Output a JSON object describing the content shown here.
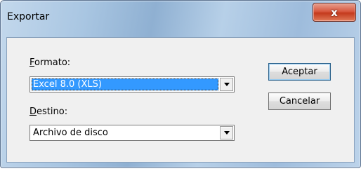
{
  "window": {
    "title": "Exportar",
    "close_label": "x"
  },
  "form": {
    "formato_label_accel": "F",
    "formato_label_rest": "ormato:",
    "formato_value": "Excel 8.0 (XLS)",
    "destino_label_accel": "D",
    "destino_label_rest": "estino:",
    "destino_value": "Archivo de disco"
  },
  "buttons": {
    "accept_label": "Aceptar",
    "cancel_label": "Cancelar"
  }
}
